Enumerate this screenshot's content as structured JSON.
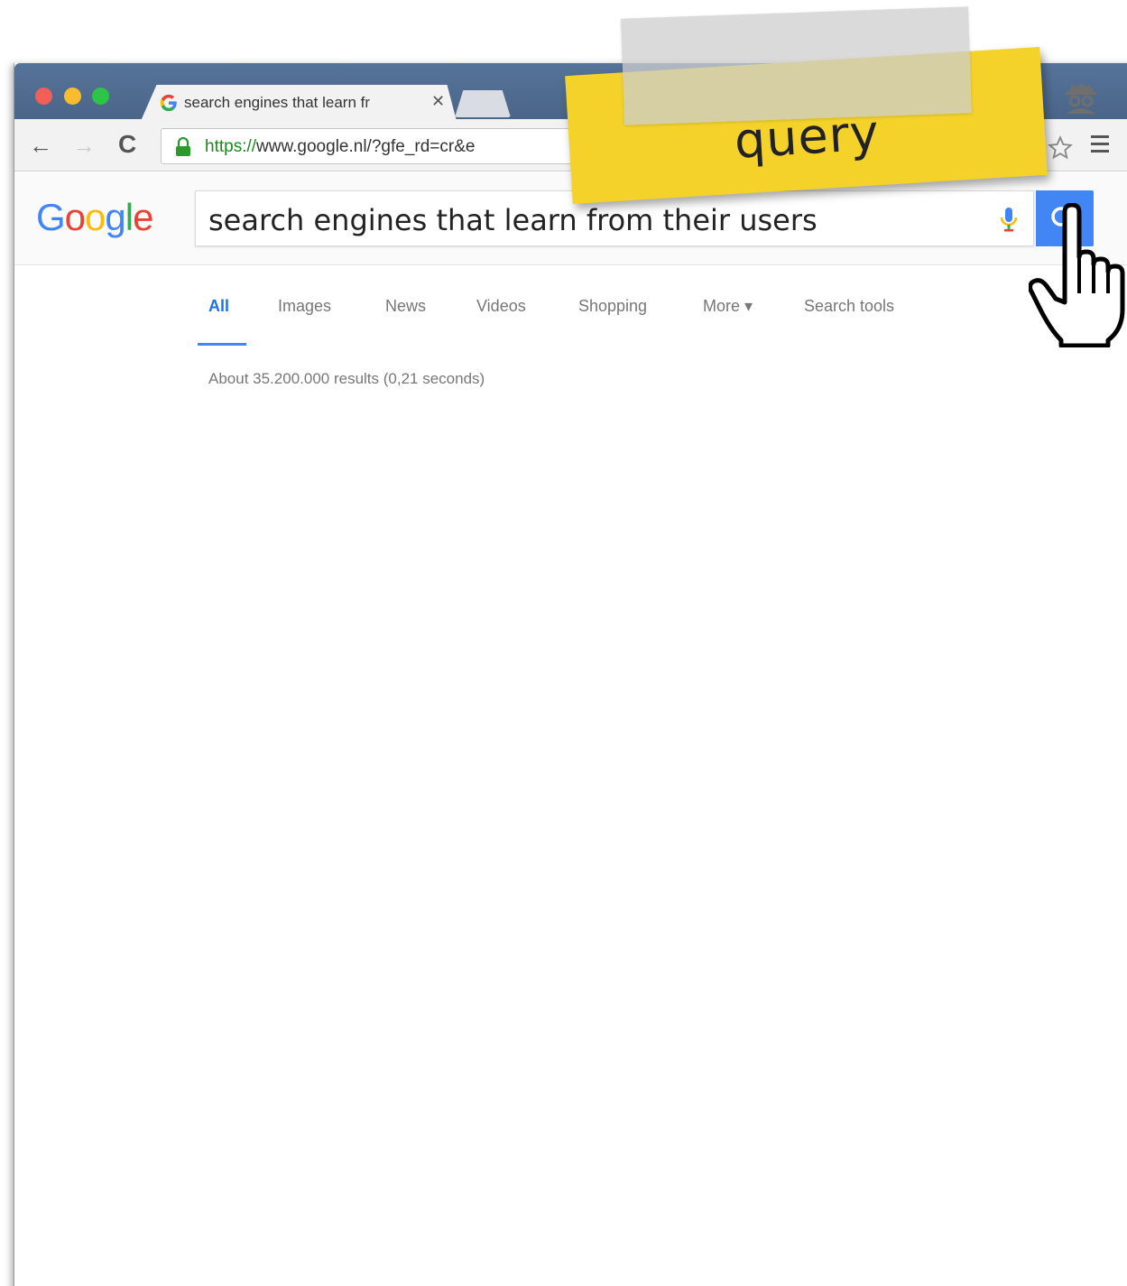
{
  "browser": {
    "tab": {
      "title": "search engines that learn fr",
      "close_glyph": "✕"
    },
    "toolbar": {
      "back_glyph": "←",
      "forward_glyph": "→",
      "reload_glyph": "C",
      "url_scheme": "https://",
      "url_rest": "www.google.nl/?gfe_rd=cr&e"
    },
    "icons": [
      "red-close-dot",
      "yellow-minimize-dot",
      "green-zoom-dot",
      "google-favicon",
      "incognito-icon",
      "lock-icon",
      "star-icon",
      "menu-icon"
    ]
  },
  "google": {
    "logo": [
      "G",
      "o",
      "o",
      "g",
      "l",
      "e"
    ],
    "search_query": "search engines that learn from their users",
    "tabs": [
      {
        "label": "All",
        "active": true
      },
      {
        "label": "Images",
        "active": false
      },
      {
        "label": "News",
        "active": false
      },
      {
        "label": "Videos",
        "active": false
      },
      {
        "label": "Shopping",
        "active": false
      },
      {
        "label": "More ▾",
        "active": false
      },
      {
        "label": "Search tools",
        "active": false
      }
    ],
    "result_stats": "About 35.200.000 results (0,21 seconds)"
  },
  "annotation": {
    "sticky_label": "query",
    "sticky_color": "#f4d22a"
  },
  "colors": {
    "chrome_frame": "#4f6b8f",
    "google_blue": "#4285f4",
    "google_red": "#ea4335",
    "google_yellow": "#fbbc05",
    "google_green": "#34a853"
  }
}
